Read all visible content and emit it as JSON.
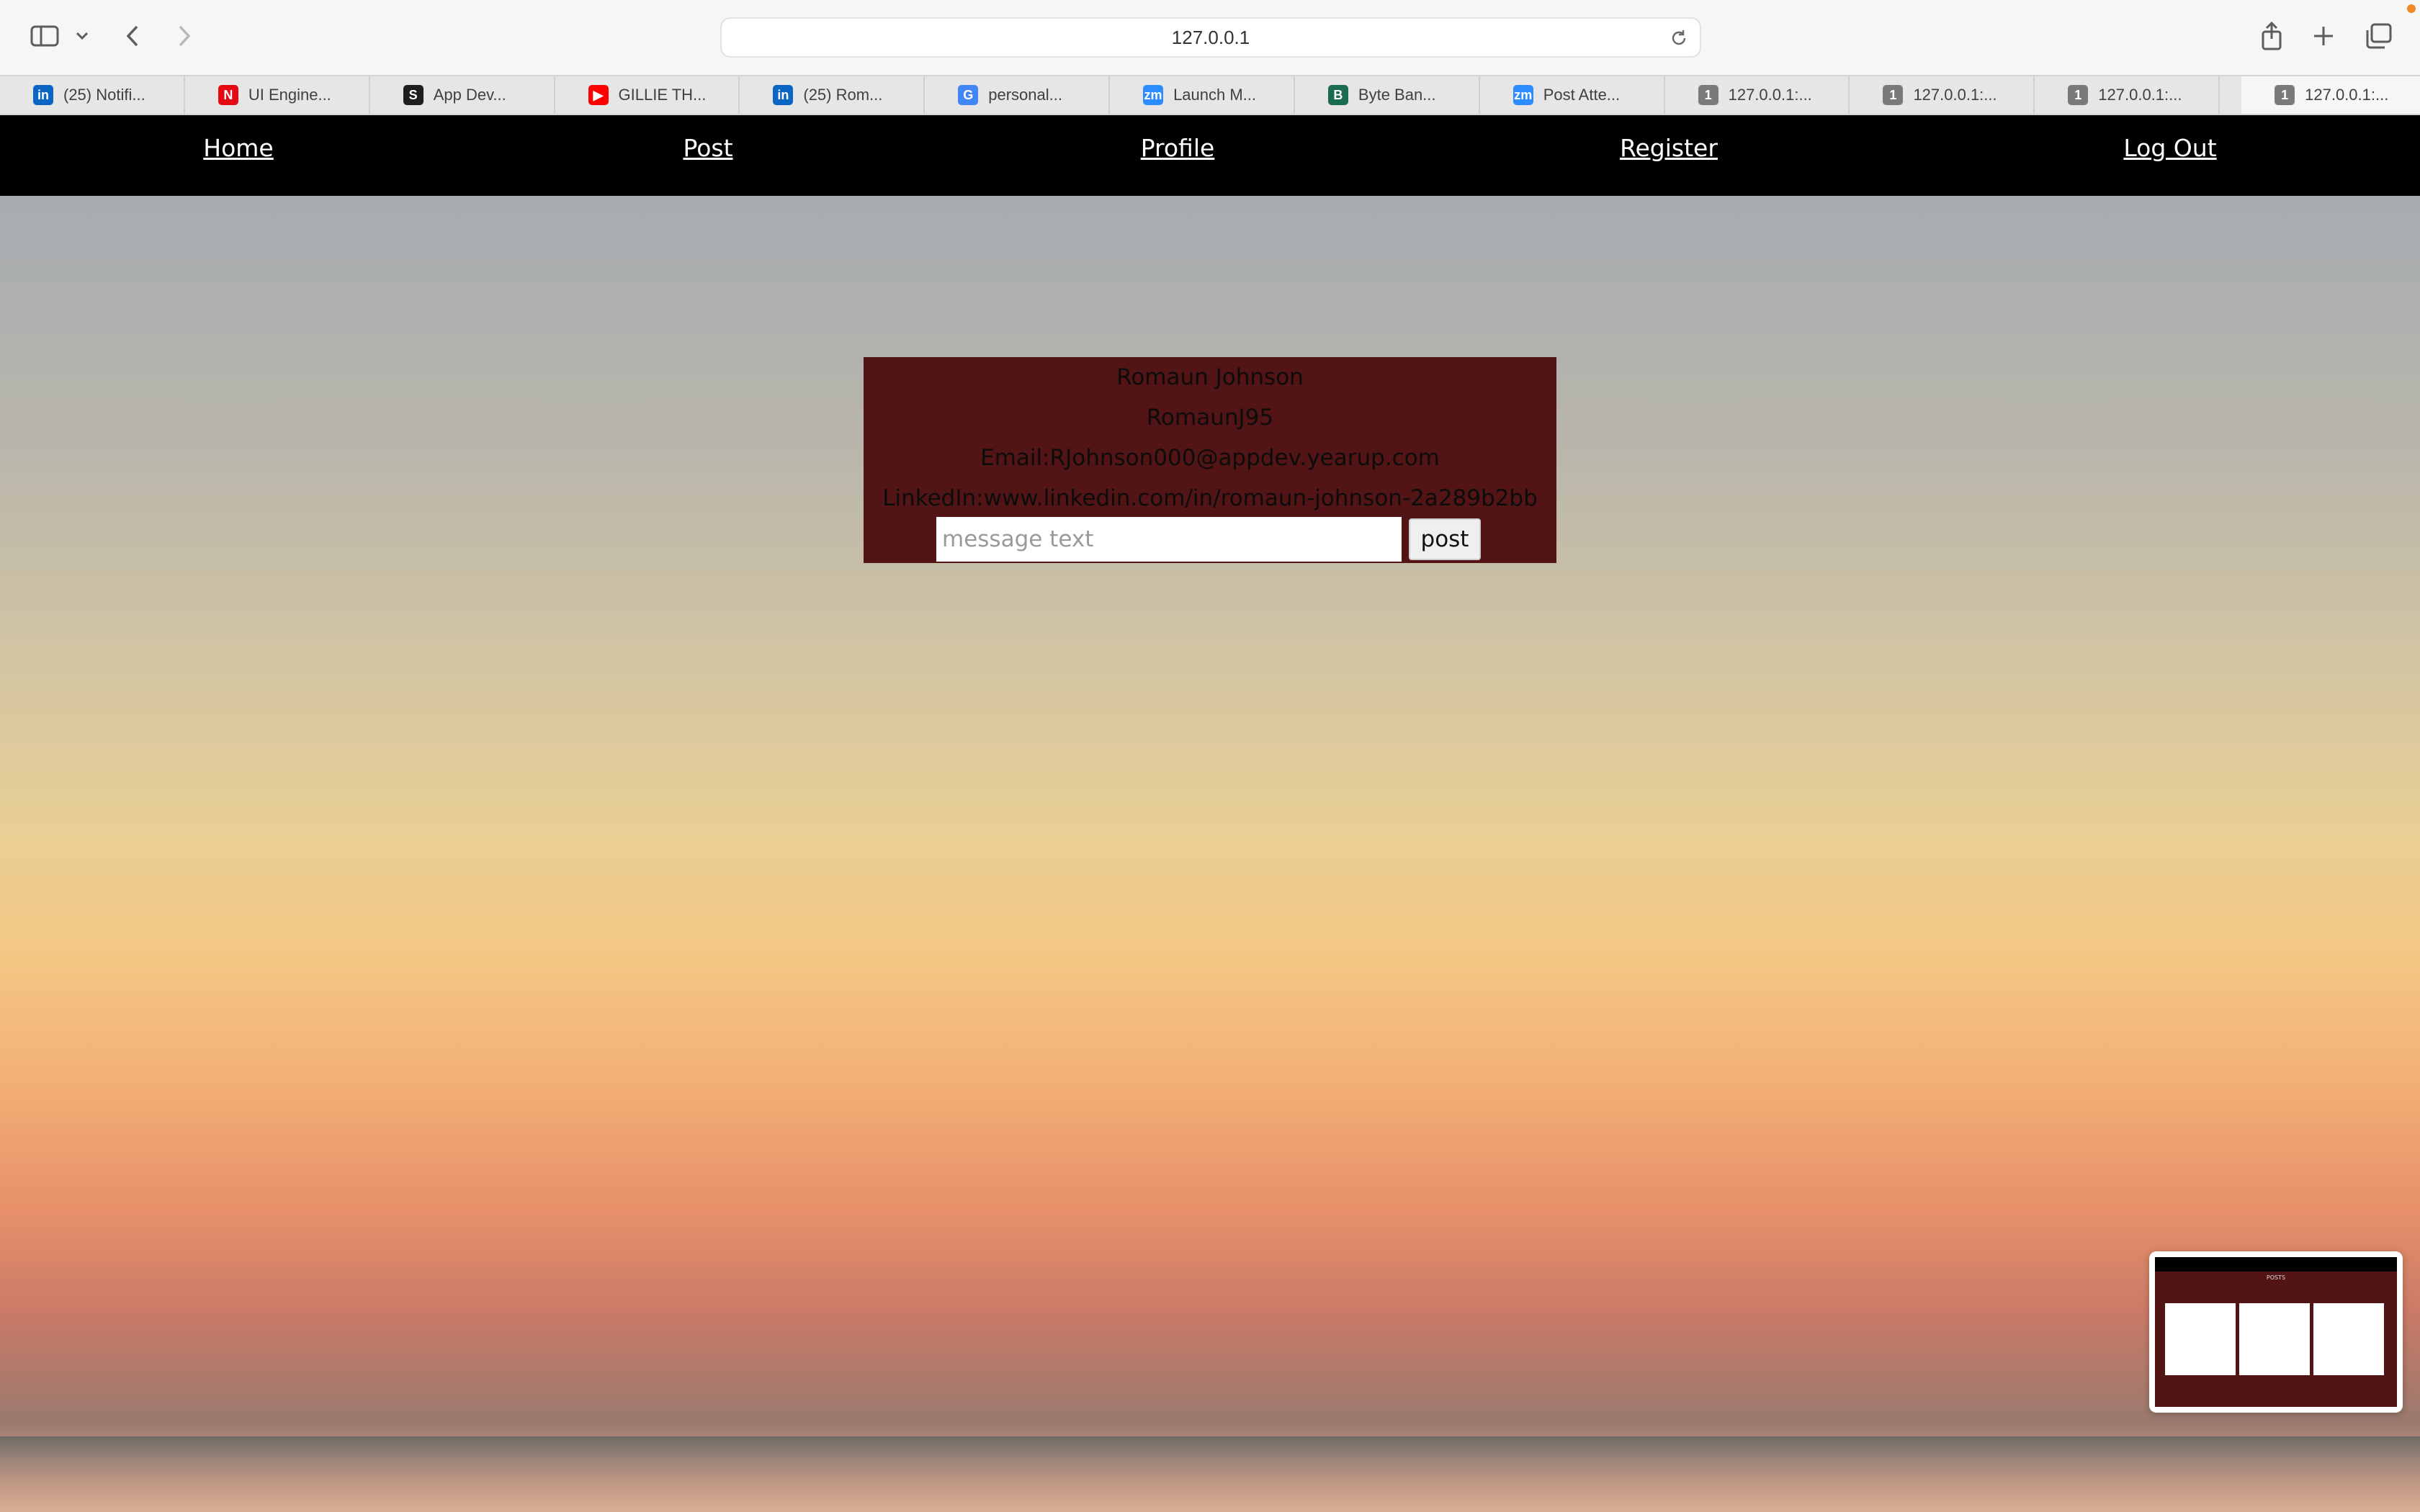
{
  "browser": {
    "url": "127.0.0.1",
    "tabs": [
      {
        "label": "(25) Notifi...",
        "icon": "linkedin-icon",
        "color": "#0a66c2",
        "glyph": "in"
      },
      {
        "label": "UI Engine...",
        "icon": "netflix-icon",
        "color": "#e50914",
        "glyph": "N"
      },
      {
        "label": "App Dev...",
        "icon": "skype-icon",
        "color": "#1e1e1e",
        "glyph": "S"
      },
      {
        "label": "GILLIE TH...",
        "icon": "youtube-icon",
        "color": "#ff0000",
        "glyph": "▶"
      },
      {
        "label": "(25) Rom...",
        "icon": "linkedin-icon",
        "color": "#0a66c2",
        "glyph": "in"
      },
      {
        "label": "personal...",
        "icon": "google-icon",
        "color": "#4285f4",
        "glyph": "G"
      },
      {
        "label": "Launch M...",
        "icon": "zoom-icon",
        "color": "#2d8cff",
        "glyph": "zm"
      },
      {
        "label": "Byte Ban...",
        "icon": "byte-bank-icon",
        "color": "#1b6b52",
        "glyph": "B"
      },
      {
        "label": "Post Atte...",
        "icon": "zoom-icon",
        "color": "#2d8cff",
        "glyph": "zm"
      },
      {
        "label": "127.0.0.1:...",
        "icon": "site-icon",
        "color": "#7a7a7a",
        "glyph": "1"
      },
      {
        "label": "127.0.0.1:...",
        "icon": "site-icon",
        "color": "#7a7a7a",
        "glyph": "1"
      },
      {
        "label": "127.0.0.1:...",
        "icon": "site-icon",
        "color": "#7a7a7a",
        "glyph": "1"
      },
      {
        "label": "127.0.0.1:...",
        "icon": "site-icon",
        "color": "#7a7a7a",
        "glyph": "1",
        "active": true
      }
    ]
  },
  "nav": {
    "home": "Home",
    "post": "Post",
    "profile": "Profile",
    "register": "Register",
    "logout": "Log Out"
  },
  "profile": {
    "name": "Romaun Johnson",
    "username": "RomaunJ95",
    "email": "Email:RJohnson000@appdev.yearup.com",
    "linkedin": "LinkedIn:www.linkedin.com/in/romaun-johnson-2a289b2bb",
    "message_value": "",
    "message_placeholder": "message text",
    "post_label": "post"
  },
  "preview": {
    "title": "POSTS"
  },
  "colors": {
    "nav_bg": "#000000",
    "card_bg": "#521414",
    "accent": "#f2ae74"
  }
}
